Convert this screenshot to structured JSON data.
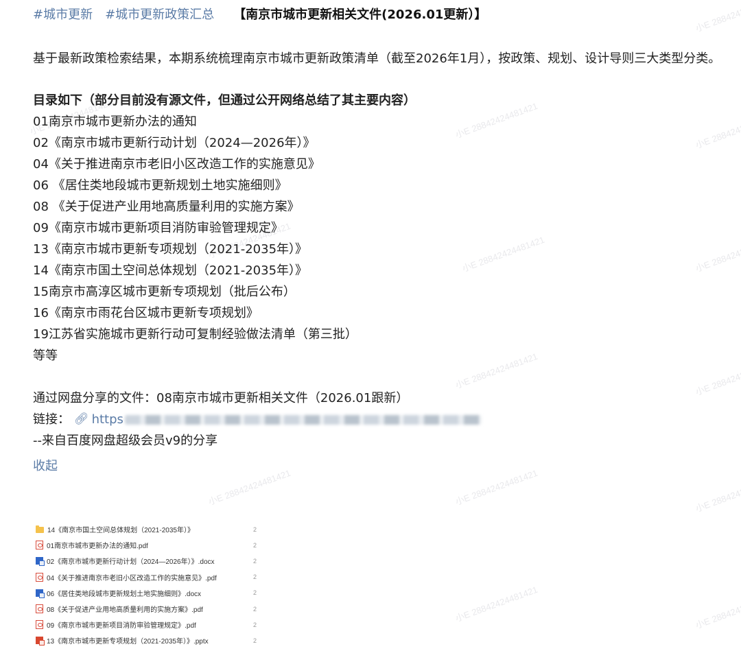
{
  "watermark_text": "小E 28842424481421",
  "post": {
    "hashtags": [
      "#城市更新",
      "#城市更新政策汇总"
    ],
    "title": "【南京市城市更新相关文件(2026.01更新）】",
    "intro": "基于最新政策检索结果，本期系统梳理南京市城市更新政策清单（截至2026年1月），按政策、规划、设计导则三大类型分类。",
    "toc_heading": "目录如下（部分目前没有源文件，但通过公开网络总结了其主要内容）",
    "toc_items": [
      "01南京市城市更新办法的通知",
      "02《南京市城市更新行动计划（2024—2026年）》",
      "04《关于推进南京市老旧小区改造工作的实施意见》",
      "06 《居住类地段城市更新规划土地实施细则》",
      "08 《关于促进产业用地高质量利用的实施方案》",
      "09《南京市城市更新项目消防审验管理规定》",
      "13《南京市城市更新专项规划（2021-2035年）》",
      "14《南京市国土空间总体规划（2021-2035年）》",
      "15南京市高淳区城市更新专项规划（批后公布）",
      "16《南京市雨花台区城市更新专项规划》",
      "19江苏省实施城市更新行动可复制经验做法清单（第三批）",
      "等等"
    ],
    "share_line": "通过网盘分享的文件：08南京市城市更新相关文件（2026.01跟新）",
    "link_label": "链接：",
    "link_text": "https",
    "from_line": "--来自百度网盘超级会员v9的分享",
    "collapse_label": "收起"
  },
  "files": [
    {
      "name": "14《南京市国土空间总体规划（2021-2035年）》",
      "type": "folder",
      "col": "2"
    },
    {
      "name": "01南京市城市更新办法的通知.pdf",
      "type": "pdf",
      "col": "2"
    },
    {
      "name": "02《南京市城市更新行动计划（2024—2026年）》.docx",
      "type": "docx",
      "col": "2"
    },
    {
      "name": "04《关于推进南京市老旧小区改造工作的实施意见》.pdf",
      "type": "pdf",
      "col": "2"
    },
    {
      "name": "06《居住类地段城市更新规划土地实施细则》.docx",
      "type": "docx",
      "col": "2"
    },
    {
      "name": "08《关于促进产业用地高质量利用的实施方案》.pdf",
      "type": "pdf",
      "col": "2"
    },
    {
      "name": "09《南京市城市更新项目消防审验管理规定》.pdf",
      "type": "pdf",
      "col": "2"
    },
    {
      "name": "13《南京市城市更新专项规划（2021-2035年）》.pptx",
      "type": "pptx",
      "col": "2"
    }
  ]
}
